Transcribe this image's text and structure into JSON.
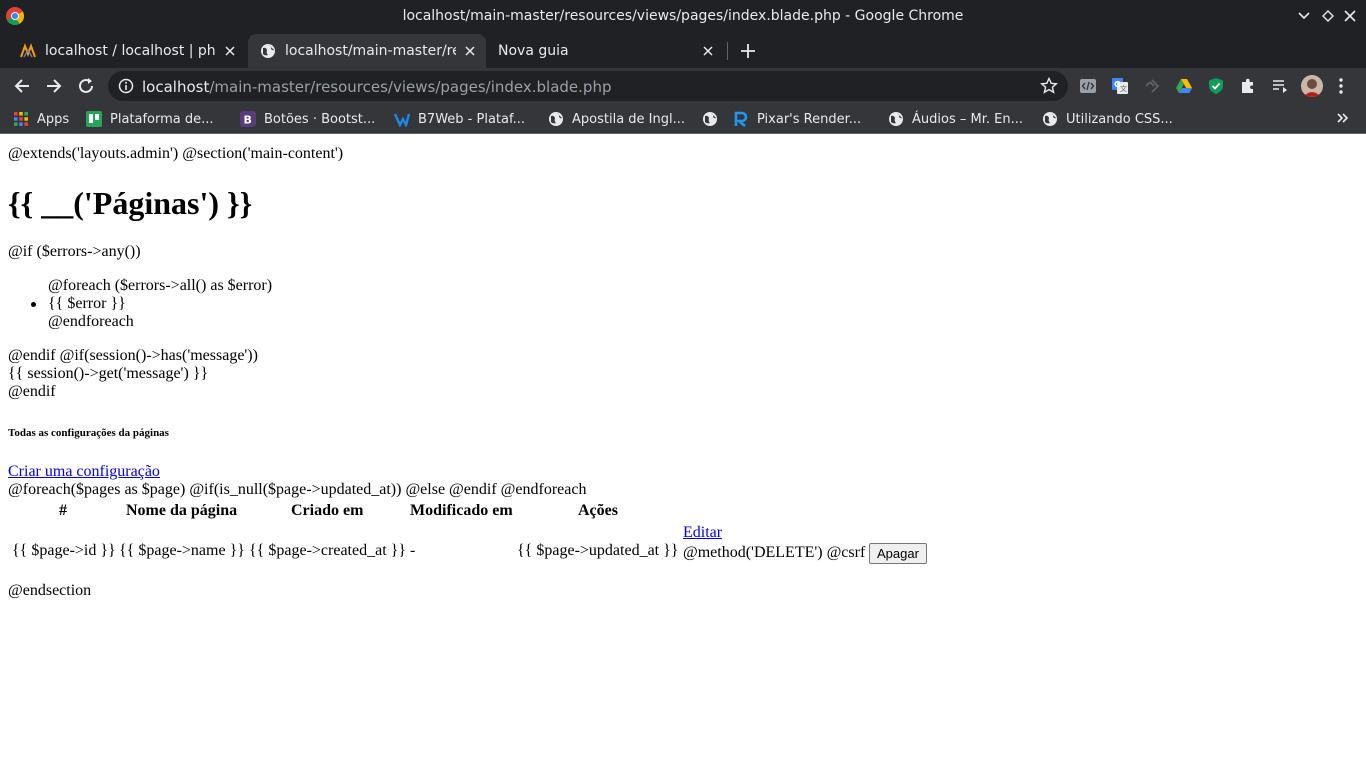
{
  "window": {
    "title": "localhost/main-master/resources/views/pages/index.blade.php - Google Chrome"
  },
  "tabs": [
    {
      "label": "localhost / localhost | phpM",
      "active": false
    },
    {
      "label": "localhost/main-master/resc",
      "active": true
    },
    {
      "label": "Nova guia",
      "active": false
    }
  ],
  "omnibox": {
    "host": "localhost",
    "path": "/main-master/resources/views/pages/index.blade.php"
  },
  "bookmarks": [
    {
      "label": "Apps",
      "icon": "apps-grid-icon"
    },
    {
      "label": "Plataforma de...",
      "icon": "trello-icon"
    },
    {
      "label": "Botões · Bootst...",
      "icon": "bootstrap-icon"
    },
    {
      "label": "B7Web - Plataf...",
      "icon": "b7web-icon"
    },
    {
      "label": "Apostila de Ingl...",
      "icon": "globe-icon"
    },
    {
      "label": "",
      "icon": "globe-icon"
    },
    {
      "label": "Pixar's Render...",
      "icon": "renderman-icon"
    },
    {
      "label": "Áudios – Mr. En...",
      "icon": "globe-icon"
    },
    {
      "label": "Utilizando CSS...",
      "icon": "globe-icon"
    }
  ],
  "page": {
    "line1": "@extends('layouts.admin') @section('main-content')",
    "heading": "{{ __('Páginas') }}",
    "line2": "@if ($errors->any())",
    "line3": "@foreach ($errors->all() as $error)",
    "list_item": "{{ $error }}",
    "line4": "@endforeach",
    "line5": "@endif @if(session()->has('message'))",
    "line6": "{{ session()->get('message') }}",
    "line7": "@endif",
    "subheading": "Todas as configurações da páginas",
    "create_link": "Criar uma configuração",
    "line8": "@foreach($pages as $page) @if(is_null($page->updated_at)) @else @endif @endforeach",
    "table": {
      "headers": [
        "#",
        "Nome da página",
        "Criado em",
        "Modificado em",
        "Ações"
      ],
      "cells": [
        "{{ $page->id }}",
        "{{ $page->name }}",
        "{{ $page->created_at }}",
        "-",
        "{{ $page->updated_at }}"
      ],
      "edit_link": "Editar",
      "method_text": "@method('DELETE') @csrf",
      "delete_button": "Apagar"
    },
    "line9": "@endsection"
  }
}
